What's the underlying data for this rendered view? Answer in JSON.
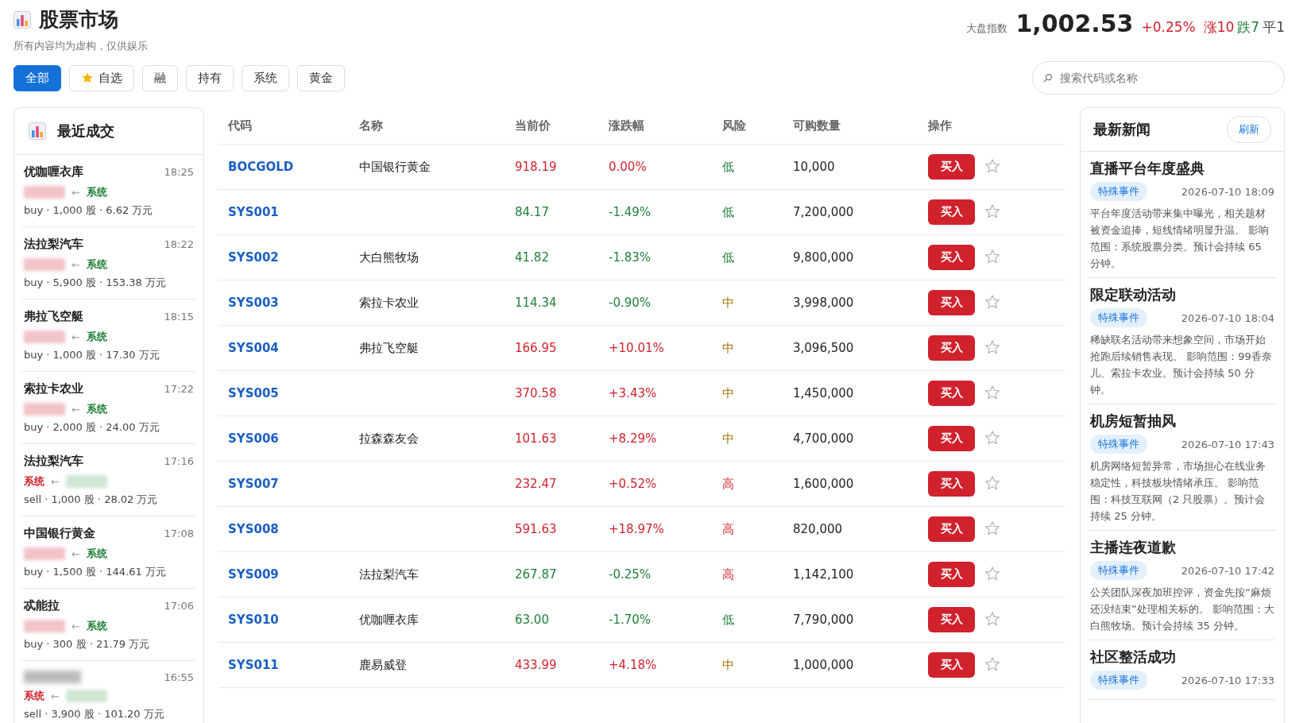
{
  "header": {
    "title": "股票市场",
    "subtitle": "所有内容均为虚构，仅供娱乐",
    "index_label": "大盘指数",
    "index_value": "1,002.53",
    "index_change": "+0.25%",
    "index_rising": true,
    "breadth": [
      {
        "text": "涨10",
        "color": "#d0222d"
      },
      {
        "text": "跌7",
        "color": "#1f7f38"
      },
      {
        "text": "平1",
        "color": "#444444"
      }
    ]
  },
  "tabs": [
    {
      "label": "全部",
      "selected": true,
      "kind": "plain"
    },
    {
      "label": "自选",
      "selected": false,
      "kind": "star"
    },
    {
      "label": "融",
      "selected": false,
      "kind": "plain"
    },
    {
      "label": "持有",
      "selected": false,
      "kind": "plain"
    },
    {
      "label": "系统",
      "selected": false,
      "kind": "plain"
    },
    {
      "label": "黄金",
      "selected": false,
      "kind": "plain"
    }
  ],
  "search": {
    "placeholder": "搜索代码或名称"
  },
  "trades_panel": {
    "title": "最近成交",
    "trades": [
      {
        "title": "优咖喱衣库",
        "time": "18:25",
        "kind": "buy",
        "arrow": "←",
        "system": "系统",
        "detail": "buy · 1,000 股 · 6.62 万元"
      },
      {
        "title": "法拉梨汽车",
        "time": "18:22",
        "kind": "buy",
        "arrow": "←",
        "system": "系统",
        "detail": "buy · 5,900 股 · 153.38 万元"
      },
      {
        "title": "弗拉飞空艇",
        "time": "18:15",
        "kind": "buy",
        "arrow": "←",
        "system": "系统",
        "detail": "buy · 1,000 股 · 17.30 万元"
      },
      {
        "title": "索拉卡农业",
        "time": "17:22",
        "kind": "buy",
        "arrow": "←",
        "system": "系统",
        "detail": "buy · 2,000 股 · 24.00 万元"
      },
      {
        "title": "法拉梨汽车",
        "time": "17:16",
        "kind": "sell",
        "arrow": "←",
        "system": "系统",
        "detail": "sell · 1,000 股 · 28.02 万元"
      },
      {
        "title": "中国银行黄金",
        "time": "17:08",
        "kind": "buy",
        "arrow": "←",
        "system": "系统",
        "detail": "buy · 1,500 股 · 144.61 万元"
      },
      {
        "title": "忒能拉",
        "time": "17:06",
        "kind": "buy",
        "arrow": "←",
        "system": "系统",
        "detail": "buy · 300 股 · 21.79 万元"
      },
      {
        "time": "16:55",
        "kind": "sell",
        "arrow": "←",
        "system": "系统",
        "detail": "sell · 3,900 股 · 101.20 万元"
      }
    ]
  },
  "table": {
    "columns": [
      "代码",
      "名称",
      "当前价",
      "涨跌幅",
      "风险",
      "可购数量",
      "操作"
    ],
    "rows": [
      {
        "code": "BOCGOLD",
        "name": "中国银行黄金",
        "price": "918.19",
        "change": "0.00%",
        "rising": true,
        "risk": "低",
        "color": "#1f7f38",
        "available": "10,000",
        "action": "买入",
        "starred": false
      },
      {
        "code": "SYS001",
        "price": "84.17",
        "change": "-1.49%",
        "rising": false,
        "risk": "低",
        "color": "#1f7f38",
        "available": "7,200,000",
        "action": "买入",
        "starred": false
      },
      {
        "code": "SYS002",
        "name": "大白熊牧场",
        "price": "41.82",
        "change": "-1.83%",
        "rising": false,
        "risk": "低",
        "color": "#1f7f38",
        "available": "9,800,000",
        "action": "买入",
        "starred": false
      },
      {
        "code": "SYS003",
        "name": "索拉卡农业",
        "price": "114.34",
        "change": "-0.90%",
        "rising": false,
        "risk": "中",
        "color": "#a8740a",
        "available": "3,998,000",
        "action": "买入",
        "starred": false
      },
      {
        "code": "SYS004",
        "name": "弗拉飞空艇",
        "price": "166.95",
        "change": "+10.01%",
        "rising": true,
        "risk": "中",
        "color": "#a8740a",
        "available": "3,096,500",
        "action": "买入",
        "starred": false
      },
      {
        "code": "SYS005",
        "price": "370.58",
        "change": "+3.43%",
        "rising": true,
        "risk": "中",
        "color": "#a8740a",
        "available": "1,450,000",
        "action": "买入",
        "starred": false
      },
      {
        "code": "SYS006",
        "name": "拉森森友会",
        "price": "101.63",
        "change": "+8.29%",
        "rising": true,
        "risk": "中",
        "color": "#a8740a",
        "available": "4,700,000",
        "action": "买入",
        "starred": false
      },
      {
        "code": "SYS007",
        "price": "232.47",
        "change": "+0.52%",
        "rising": true,
        "risk": "高",
        "color": "#d0222d",
        "available": "1,600,000",
        "action": "买入",
        "starred": false
      },
      {
        "code": "SYS008",
        "price": "591.63",
        "change": "+18.97%",
        "rising": true,
        "risk": "高",
        "color": "#d0222d",
        "available": "820,000",
        "action": "买入",
        "starred": false
      },
      {
        "code": "SYS009",
        "name": "法拉梨汽车",
        "price": "267.87",
        "change": "-0.25%",
        "rising": false,
        "risk": "高",
        "color": "#d0222d",
        "available": "1,142,100",
        "action": "买入",
        "starred": false
      },
      {
        "code": "SYS010",
        "name": "优咖喱衣库",
        "price": "63.00",
        "change": "-1.70%",
        "rising": false,
        "risk": "低",
        "color": "#1f7f38",
        "available": "7,790,000",
        "action": "买入",
        "starred": false
      },
      {
        "code": "SYS011",
        "name": "鹿易威登",
        "price": "433.99",
        "change": "+4.18%",
        "rising": true,
        "risk": "中",
        "color": "#a8740a",
        "available": "1,000,000",
        "action": "买入",
        "starred": false
      }
    ]
  },
  "news_panel": {
    "title": "最新新闻",
    "refresh": "刷新",
    "items": [
      {
        "title": "直播平台年度盛典",
        "tag": "特殊事件",
        "time": "2026-07-10 18:09",
        "body": "平台年度活动带来集中曝光，相关题材被资金追捧，短线情绪明显升温。 影响范围：系统股票分类。预计会持续 65 分钟。"
      },
      {
        "title": "限定联动活动",
        "tag": "特殊事件",
        "time": "2026-07-10 18:04",
        "body": "稀缺联名活动带来想象空间，市场开始抢跑后续销售表现。 影响范围：99香奈儿、索拉卡农业。预计会持续 50 分钟。"
      },
      {
        "title": "机房短暂抽风",
        "tag": "特殊事件",
        "time": "2026-07-10 17:43",
        "body": "机房网络短暂异常，市场担心在线业务稳定性，科技板块情绪承压。 影响范围：科技互联网（2 只股票）。预计会持续 25 分钟。"
      },
      {
        "title": "主播连夜道歉",
        "tag": "特殊事件",
        "time": "2026-07-10 17:42",
        "body": "公关团队深夜加班控评，资金先按“麻烦还没结束”处理相关标的。 影响范围：大白熊牧场。预计会持续 35 分钟。"
      },
      {
        "title": "社区整活成功",
        "tag": "特殊事件",
        "time": "2026-07-10 17:33"
      }
    ]
  }
}
